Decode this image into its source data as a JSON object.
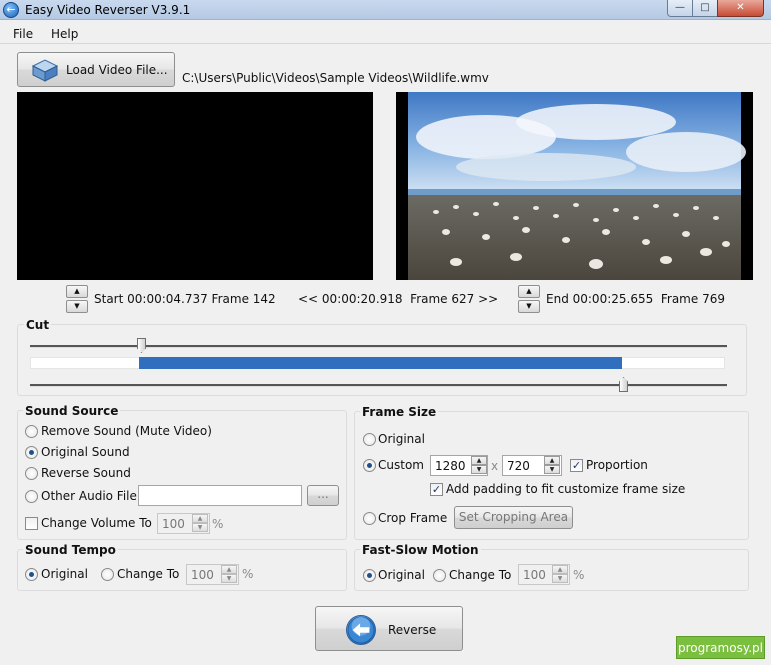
{
  "window": {
    "title": "Easy Video Reverser V3.9.1",
    "minimize_icon": "minimize-icon",
    "maximize_icon": "maximize-icon",
    "close_icon": "close-icon"
  },
  "menu": {
    "file": "File",
    "help": "Help"
  },
  "load": {
    "label": "Load Video File...",
    "path": "C:\\Users\\Public\\Videos\\Sample Videos\\Wildlife.wmv"
  },
  "timeline": {
    "start": "Start 00:00:04.737 Frame 142",
    "middle": "<< 00:00:20.918  Frame 627 >>",
    "end": "End 00:00:25.655  Frame 769",
    "range_start_fraction": 0.158,
    "range_end_fraction": 0.851
  },
  "cut": {
    "title": "Cut"
  },
  "sound_source": {
    "title": "Sound Source",
    "options": [
      "Remove Sound (Mute Video)",
      "Original Sound",
      "Reverse Sound",
      "Other Audio File"
    ],
    "selected": "Original Sound",
    "browse_label": "...",
    "change_volume_label": "Change Volume To",
    "volume_value": "100",
    "volume_unit": "%"
  },
  "frame_size": {
    "title": "Frame Size",
    "original_label": "Original",
    "custom_label": "Custom",
    "width": "1280",
    "height": "720",
    "x_sep": "x",
    "proportion_label": "Proportion",
    "proportion_checked": true,
    "padding_label": "Add padding to fit customize frame size",
    "padding_checked": true,
    "crop_label": "Crop Frame",
    "crop_button": "Set Cropping Area",
    "selected": "Custom"
  },
  "sound_tempo": {
    "title": "Sound Tempo",
    "original_label": "Original",
    "change_label": "Change To",
    "value": "100",
    "unit": "%"
  },
  "fast_slow": {
    "title": "Fast-Slow Motion",
    "original_label": "Original",
    "change_label": "Change To",
    "value": "100",
    "unit": "%"
  },
  "reverse_button": "Reverse",
  "watermark": "programosy.pl",
  "colors": {
    "range_fill": "#2f6fbd",
    "watermark": "#7bbf3e"
  }
}
